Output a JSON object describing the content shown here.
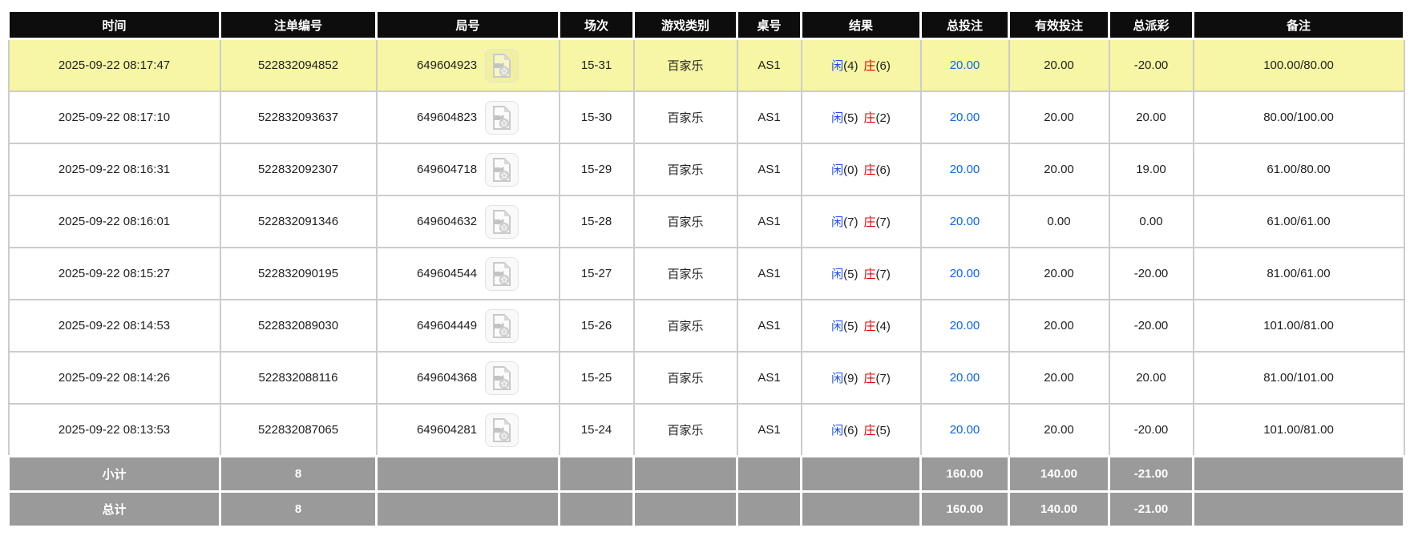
{
  "header": {
    "columns": [
      {
        "key": "time",
        "label": "时间"
      },
      {
        "key": "bet-id",
        "label": "注单编号"
      },
      {
        "key": "round-id",
        "label": "局号"
      },
      {
        "key": "session",
        "label": "场次"
      },
      {
        "key": "game-type",
        "label": "游戏类别"
      },
      {
        "key": "table-no",
        "label": "桌号"
      },
      {
        "key": "result",
        "label": "结果"
      },
      {
        "key": "total-bet",
        "label": "总投注"
      },
      {
        "key": "valid-bet",
        "label": "有效投注"
      },
      {
        "key": "payout",
        "label": "总派彩"
      },
      {
        "key": "remark",
        "label": "备注"
      }
    ]
  },
  "rows": [
    {
      "time": "2025-09-22 08:17:47",
      "bet_id": "522832094852",
      "round_id": "649604923",
      "session": "15-31",
      "game_type": "百家乐",
      "table_no": "AS1",
      "result": {
        "player_label": "闲",
        "player": "(4)",
        "banker_label": "庄",
        "banker": "(6)"
      },
      "total_bet": "20.00",
      "valid_bet": "20.00",
      "payout": "-20.00",
      "remark": "100.00/80.00",
      "highlighted": true
    },
    {
      "time": "2025-09-22 08:17:10",
      "bet_id": "522832093637",
      "round_id": "649604823",
      "session": "15-30",
      "game_type": "百家乐",
      "table_no": "AS1",
      "result": {
        "player_label": "闲",
        "player": "(5)",
        "banker_label": "庄",
        "banker": "(2)"
      },
      "total_bet": "20.00",
      "valid_bet": "20.00",
      "payout": "20.00",
      "remark": "80.00/100.00",
      "highlighted": false
    },
    {
      "time": "2025-09-22 08:16:31",
      "bet_id": "522832092307",
      "round_id": "649604718",
      "session": "15-29",
      "game_type": "百家乐",
      "table_no": "AS1",
      "result": {
        "player_label": "闲",
        "player": "(0)",
        "banker_label": "庄",
        "banker": "(6)"
      },
      "total_bet": "20.00",
      "valid_bet": "20.00",
      "payout": "19.00",
      "remark": "61.00/80.00",
      "highlighted": false
    },
    {
      "time": "2025-09-22 08:16:01",
      "bet_id": "522832091346",
      "round_id": "649604632",
      "session": "15-28",
      "game_type": "百家乐",
      "table_no": "AS1",
      "result": {
        "player_label": "闲",
        "player": "(7)",
        "banker_label": "庄",
        "banker": "(7)"
      },
      "total_bet": "20.00",
      "valid_bet": "0.00",
      "payout": "0.00",
      "remark": "61.00/61.00",
      "highlighted": false
    },
    {
      "time": "2025-09-22 08:15:27",
      "bet_id": "522832090195",
      "round_id": "649604544",
      "session": "15-27",
      "game_type": "百家乐",
      "table_no": "AS1",
      "result": {
        "player_label": "闲",
        "player": "(5)",
        "banker_label": "庄",
        "banker": "(7)"
      },
      "total_bet": "20.00",
      "valid_bet": "20.00",
      "payout": "-20.00",
      "remark": "81.00/61.00",
      "highlighted": false
    },
    {
      "time": "2025-09-22 08:14:53",
      "bet_id": "522832089030",
      "round_id": "649604449",
      "session": "15-26",
      "game_type": "百家乐",
      "table_no": "AS1",
      "result": {
        "player_label": "闲",
        "player": "(5)",
        "banker_label": "庄",
        "banker": "(4)"
      },
      "total_bet": "20.00",
      "valid_bet": "20.00",
      "payout": "-20.00",
      "remark": "101.00/81.00",
      "highlighted": false
    },
    {
      "time": "2025-09-22 08:14:26",
      "bet_id": "522832088116",
      "round_id": "649604368",
      "session": "15-25",
      "game_type": "百家乐",
      "table_no": "AS1",
      "result": {
        "player_label": "闲",
        "player": "(9)",
        "banker_label": "庄",
        "banker": "(7)"
      },
      "total_bet": "20.00",
      "valid_bet": "20.00",
      "payout": "20.00",
      "remark": "81.00/101.00",
      "highlighted": false
    },
    {
      "time": "2025-09-22 08:13:53",
      "bet_id": "522832087065",
      "round_id": "649604281",
      "session": "15-24",
      "game_type": "百家乐",
      "table_no": "AS1",
      "result": {
        "player_label": "闲",
        "player": "(6)",
        "banker_label": "庄",
        "banker": "(5)"
      },
      "total_bet": "20.00",
      "valid_bet": "20.00",
      "payout": "-20.00",
      "remark": "101.00/81.00",
      "highlighted": false
    }
  ],
  "footer": [
    {
      "label": "小计",
      "count": "8",
      "total_bet": "160.00",
      "valid_bet": "140.00",
      "payout": "-21.00"
    },
    {
      "label": "总计",
      "count": "8",
      "total_bet": "160.00",
      "valid_bet": "140.00",
      "payout": "-21.00"
    }
  ],
  "icons": {
    "video_replay": "video-replay-icon"
  },
  "colors": {
    "header_bg": "#0d0d0d",
    "highlight_row": "#f6f6a4",
    "amount_blue": "#0a66f0",
    "player_blue": "#1f4df2",
    "banker_red": "#e60000",
    "negative_red": "#ff0000",
    "footer_bg": "#9a9a9a",
    "row_border": "#cccccc"
  }
}
